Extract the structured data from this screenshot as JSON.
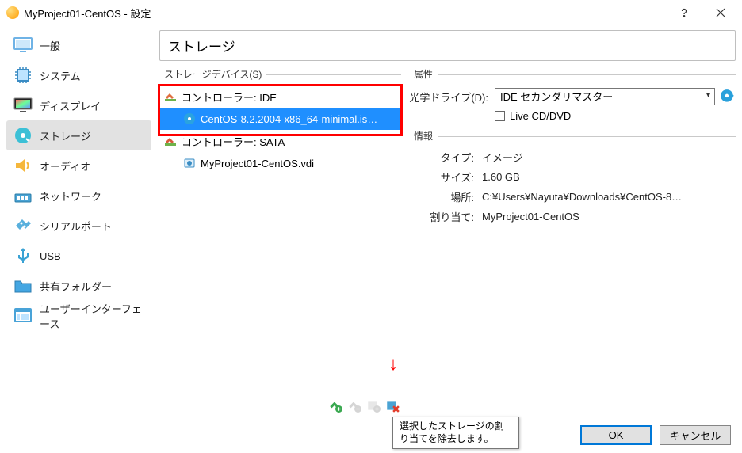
{
  "window": {
    "title": "MyProject01-CentOS - 設定"
  },
  "sidebar": {
    "items": [
      {
        "label": "一般"
      },
      {
        "label": "システム"
      },
      {
        "label": "ディスプレイ"
      },
      {
        "label": "ストレージ"
      },
      {
        "label": "オーディオ"
      },
      {
        "label": "ネットワーク"
      },
      {
        "label": "シリアルポート"
      },
      {
        "label": "USB"
      },
      {
        "label": "共有フォルダー"
      },
      {
        "label": "ユーザーインターフェース"
      }
    ]
  },
  "panel": {
    "title": "ストレージ",
    "groups": {
      "devices": "ストレージデバイス(S)",
      "attrs": "属性",
      "info": "情報"
    },
    "tree": {
      "ctrl_ide": "コントローラー: IDE",
      "ide_child": "CentOS-8.2.2004-x86_64-minimal.is…",
      "ctrl_sata": "コントローラー: SATA",
      "sata_child": "MyProject01-CentOS.vdi"
    },
    "attrs": {
      "optical_label": "光学ドライブ(D):",
      "optical_value": "IDE セカンダリマスター",
      "live_label": "Live CD/DVD"
    },
    "info": {
      "type_lbl": "タイプ:",
      "type_val": "イメージ",
      "size_lbl": "サイズ:",
      "size_val": "1.60 GB",
      "loc_lbl": "場所:",
      "loc_val": "C:¥Users¥Nayuta¥Downloads¥CentOS-8…",
      "assign_lbl": "割り当て:",
      "assign_val": "MyProject01-CentOS"
    }
  },
  "tooltip": "選択したストレージの割り当てを除去します。",
  "buttons": {
    "ok": "OK",
    "cancel": "キャンセル"
  }
}
